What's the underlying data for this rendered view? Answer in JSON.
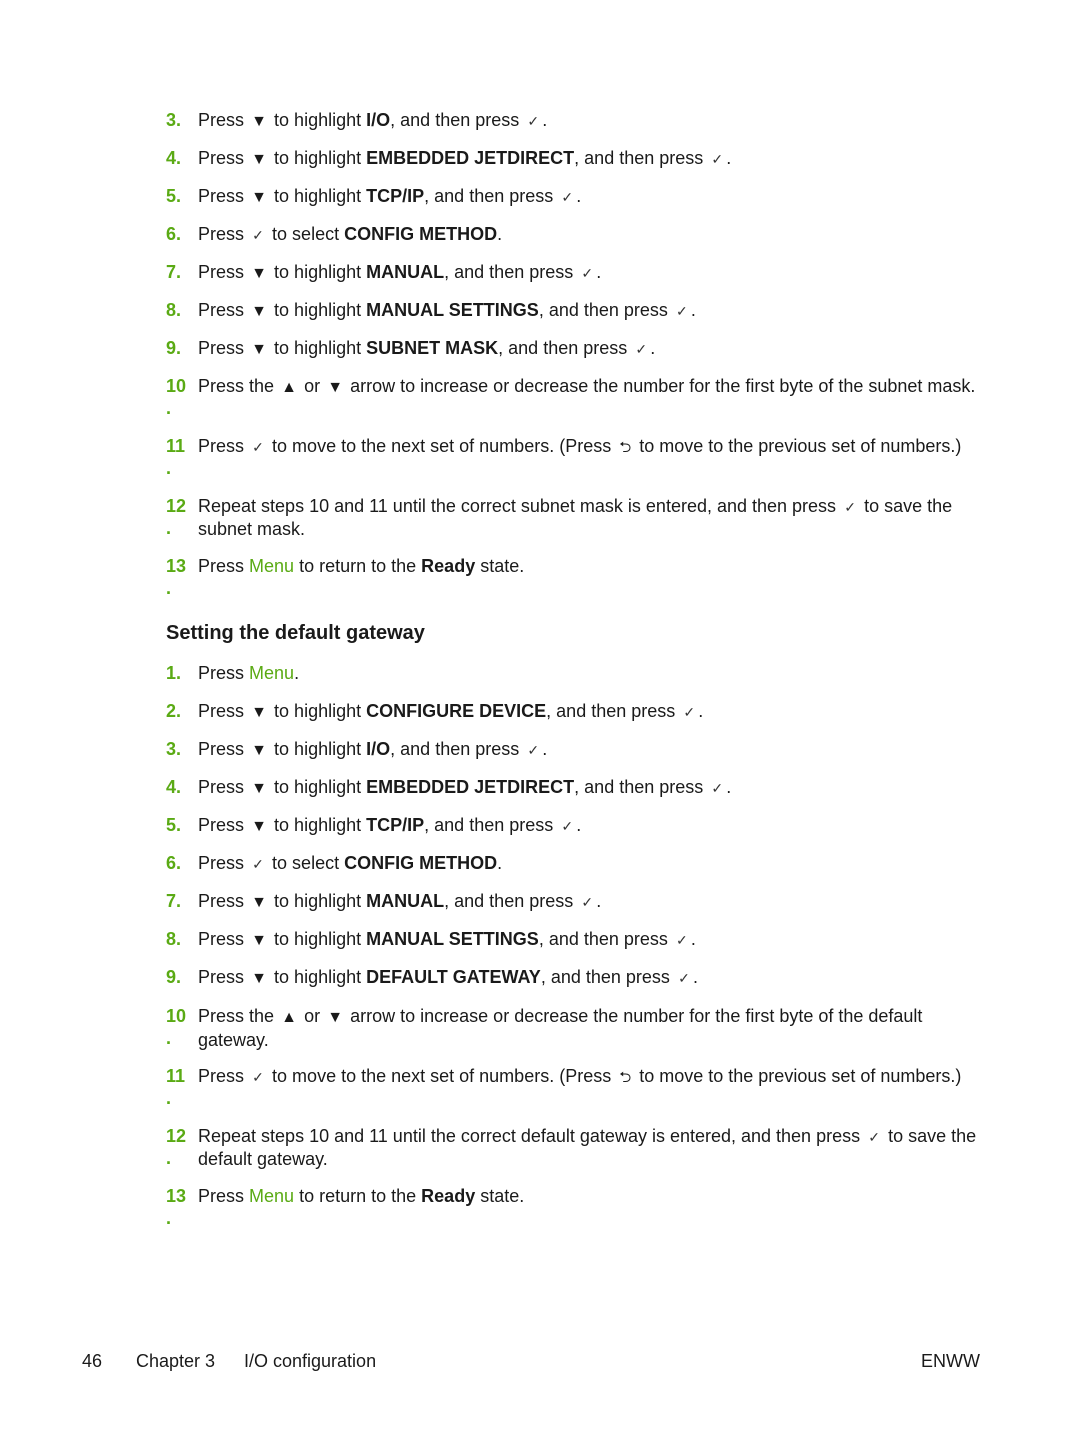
{
  "colors": {
    "accent": "#5aaa14",
    "text": "#1a1a1a"
  },
  "icons": {
    "down": "▼",
    "up": "▲",
    "check": "✓",
    "back": "⮌"
  },
  "section1": {
    "steps": [
      {
        "n": "3.",
        "a": "Press",
        "b": "to highlight",
        "hl": "I/O",
        "c": ", and then press",
        "end": "."
      },
      {
        "n": "4.",
        "a": "Press",
        "b": "to highlight",
        "hl": "EMBEDDED JETDIRECT",
        "c": ", and then press",
        "end": "."
      },
      {
        "n": "5.",
        "a": "Press",
        "b": "to highlight",
        "hl": "TCP/IP",
        "c": ", and then press",
        "end": "."
      },
      {
        "n": "6.",
        "a": "Press",
        "b": "to select",
        "hl": "CONFIG METHOD",
        "end": "."
      },
      {
        "n": "7.",
        "a": "Press",
        "b": "to highlight",
        "hl": "MANUAL",
        "c": ", and then press",
        "end": "."
      },
      {
        "n": "8.",
        "a": "Press",
        "b": "to highlight",
        "hl": "MANUAL SETTINGS",
        "c": ", and then press",
        "end": "."
      },
      {
        "n": "9.",
        "a": "Press",
        "b": "to highlight",
        "hl": "SUBNET MASK",
        "c": ", and then press",
        "end": "."
      }
    ],
    "s10": {
      "n": "10",
      "a": "Press the",
      "or": "or",
      "rest": "arrow to increase or decrease the number for the first byte of the subnet mask."
    },
    "s11": {
      "n": "11",
      "a": "Press",
      "b": "to move to the next set of numbers. (Press",
      "c": "to move to the previous set of numbers.)"
    },
    "s12": {
      "n": "12",
      "a": "Repeat steps 10 and 11 until the correct subnet mask is entered, and then press",
      "b": "to save the subnet mask."
    },
    "s13": {
      "n": "13",
      "a": "Press",
      "menu": "Menu",
      "b": "to return to the",
      "ready": "Ready",
      "c": "state."
    }
  },
  "heading": "Setting the default gateway",
  "section2": {
    "s1": {
      "n": "1.",
      "a": "Press",
      "menu": "Menu",
      "end": "."
    },
    "steps": [
      {
        "n": "2.",
        "a": "Press",
        "b": "to highlight",
        "hl": "CONFIGURE DEVICE",
        "c": ", and then press",
        "end": "."
      },
      {
        "n": "3.",
        "a": "Press",
        "b": "to highlight",
        "hl": "I/O",
        "c": ", and then press",
        "end": "."
      },
      {
        "n": "4.",
        "a": "Press",
        "b": "to highlight",
        "hl": "EMBEDDED JETDIRECT",
        "c": ", and then press",
        "end": "."
      },
      {
        "n": "5.",
        "a": "Press",
        "b": "to highlight",
        "hl": "TCP/IP",
        "c": ", and then press",
        "end": "."
      },
      {
        "n": "6.",
        "a": "Press",
        "b": "to select",
        "hl": "CONFIG METHOD",
        "end": "."
      },
      {
        "n": "7.",
        "a": "Press",
        "b": "to highlight",
        "hl": "MANUAL",
        "c": ", and then press",
        "end": "."
      },
      {
        "n": "8.",
        "a": "Press",
        "b": "to highlight",
        "hl": "MANUAL SETTINGS",
        "c": ", and then press",
        "end": "."
      },
      {
        "n": "9.",
        "a": "Press",
        "b": "to highlight",
        "hl": "DEFAULT GATEWAY",
        "c": ", and then press",
        "end": "."
      }
    ],
    "s10": {
      "n": "10",
      "a": "Press the",
      "or": "or",
      "rest": "arrow to increase or decrease the number for the first byte of the default gateway."
    },
    "s11": {
      "n": "11",
      "a": "Press",
      "b": "to move to the next set of numbers. (Press",
      "c": "to move to the previous set of numbers.)"
    },
    "s12": {
      "n": "12",
      "a": "Repeat steps 10 and 11 until the correct default gateway is entered, and then press",
      "b": "to save the default gateway."
    },
    "s13": {
      "n": "13",
      "a": "Press",
      "menu": "Menu",
      "b": "to return to the",
      "ready": "Ready",
      "c": "state."
    }
  },
  "footer": {
    "page": "46",
    "chapter": "Chapter 3",
    "title": "I/O configuration",
    "right": "ENWW"
  }
}
